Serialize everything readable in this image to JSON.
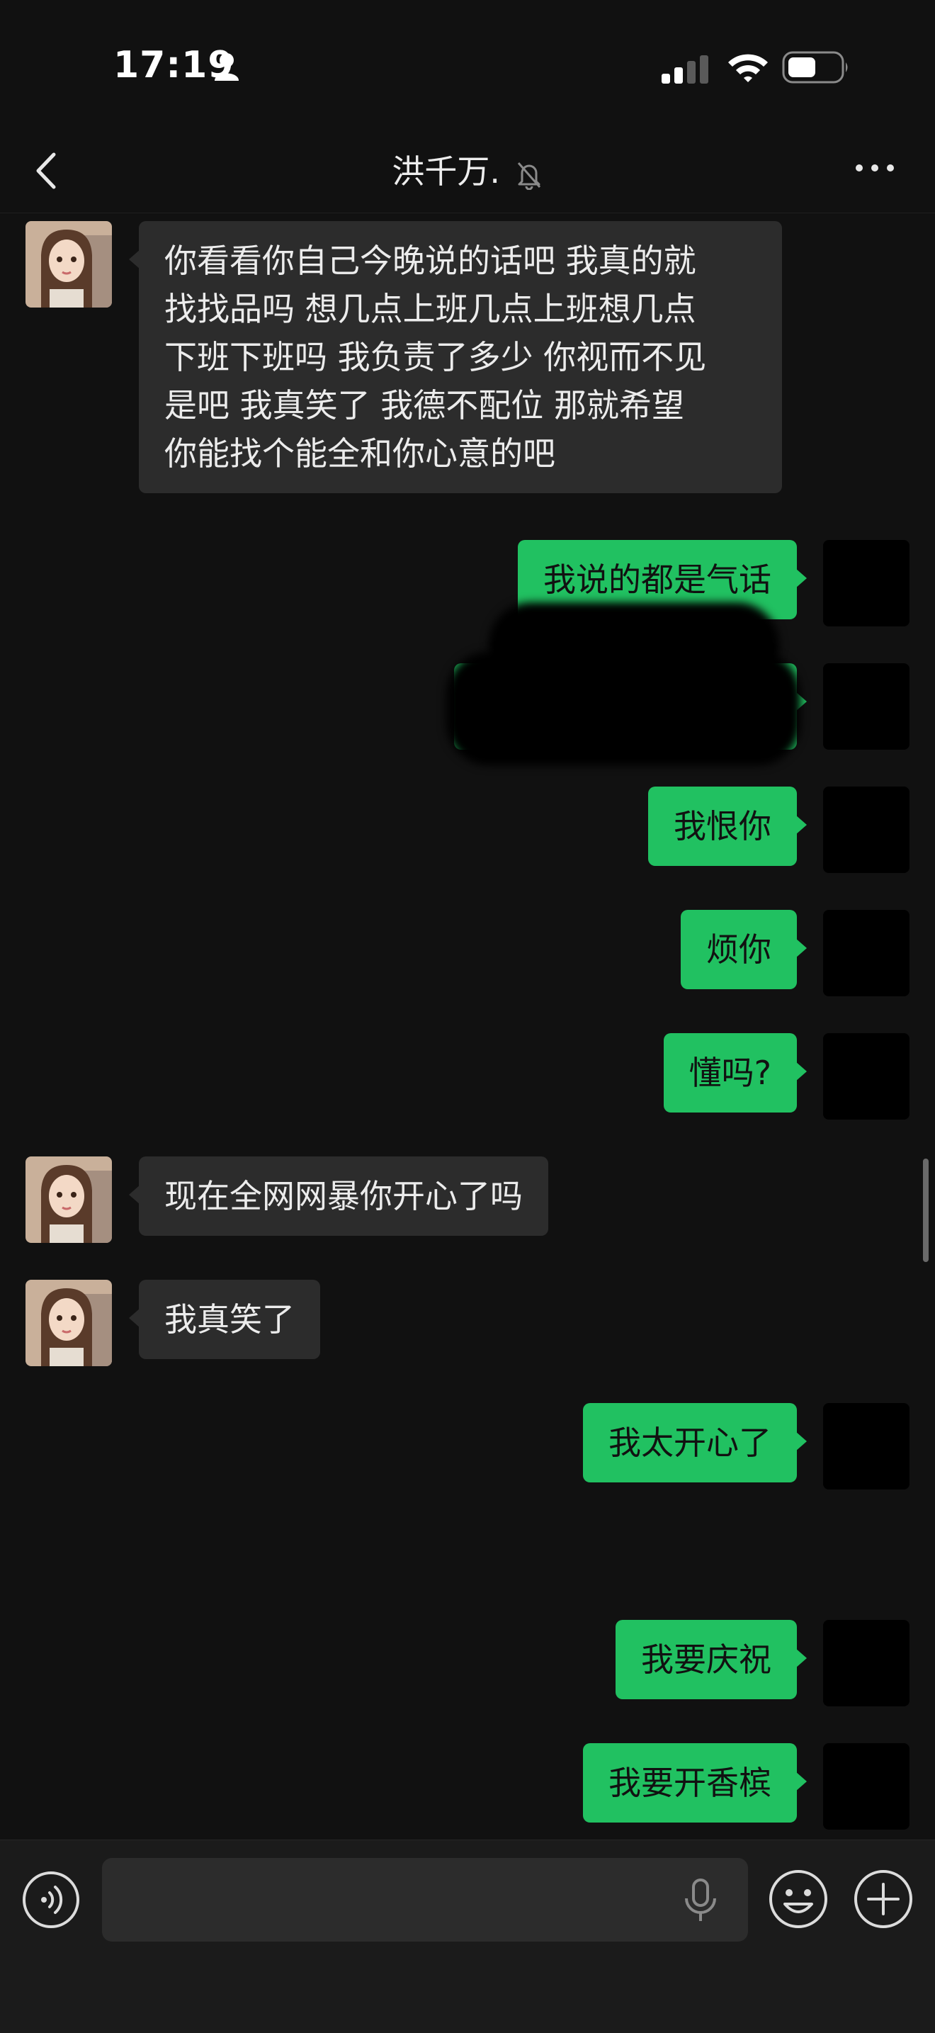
{
  "status_bar": {
    "time": "17:19"
  },
  "header": {
    "title": "洪千万."
  },
  "messages": [
    {
      "side": "recv",
      "text": "你看看你自己今晚说的话吧 我真的就\n找找品吗 想几点上班几点上班想几点\n下班下班吗 我负责了多少 你视而不见\n是吧 我真笑了 我德不配位 那就希望\n你能找个能全和你心意的吧"
    },
    {
      "side": "sent",
      "text": "我说的都是气话"
    },
    {
      "side": "sent",
      "text": ""
    },
    {
      "side": "sent",
      "text": "我恨你"
    },
    {
      "side": "sent",
      "text": "烦你"
    },
    {
      "side": "sent",
      "text": "懂吗?"
    },
    {
      "side": "recv",
      "text": "现在全网网暴你开心了吗"
    },
    {
      "side": "recv",
      "text": "我真笑了"
    },
    {
      "side": "sent",
      "text": "我太开心了"
    },
    {
      "side": "sent",
      "text": "我要庆祝"
    },
    {
      "side": "sent",
      "text": "我要开香槟"
    }
  ],
  "input": {
    "placeholder": "",
    "value": ""
  },
  "colors": {
    "sent_bubble": "#21c161",
    "recv_bubble": "#2c2c2c",
    "background": "#111111"
  },
  "icons": [
    "back-arrow",
    "mute-bell",
    "more-dots",
    "voice",
    "microphone",
    "emoji",
    "plus"
  ]
}
